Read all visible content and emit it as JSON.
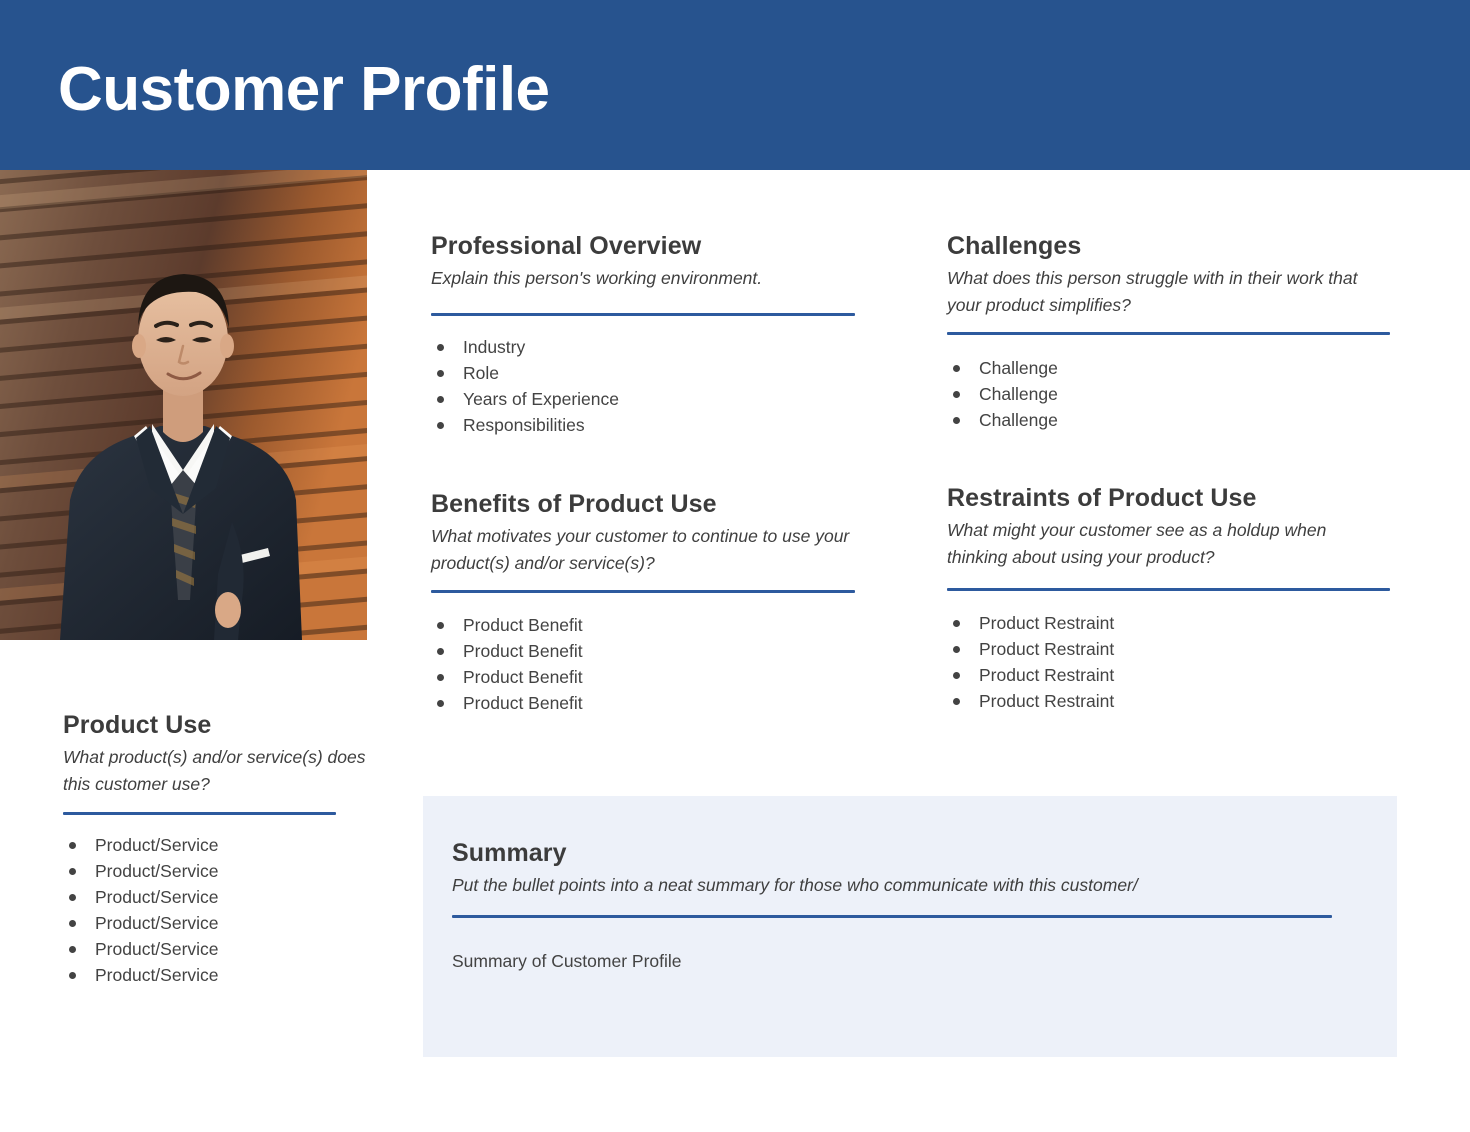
{
  "header": {
    "title": "Customer Profile",
    "background_color": "#27538E"
  },
  "photo": {
    "alt": "Professional man in dark suit standing against a wooden slat wall"
  },
  "accent_color": "#2D5A9E",
  "summary_panel_color": "#EDF1F9",
  "sections": {
    "professional_overview": {
      "title": "Professional Overview",
      "subtitle": "Explain this person's working environment.",
      "items": [
        "Industry",
        "Role",
        "Years of Experience",
        "Responsibilities"
      ]
    },
    "challenges": {
      "title": "Challenges",
      "subtitle": "What does this person struggle with in their work that your product simplifies?",
      "items": [
        "Challenge",
        "Challenge",
        "Challenge"
      ]
    },
    "benefits": {
      "title": "Benefits of Product Use",
      "subtitle": "What motivates your customer to continue to use your product(s) and/or service(s)?",
      "items": [
        "Product Benefit",
        "Product Benefit",
        "Product Benefit",
        "Product Benefit"
      ]
    },
    "restraints": {
      "title": "Restraints of Product Use",
      "subtitle": "What might your customer see as a holdup when thinking about using your product?",
      "items": [
        "Product Restraint",
        "Product Restraint",
        "Product Restraint",
        "Product Restraint"
      ]
    },
    "product_use": {
      "title": "Product Use",
      "subtitle": "What product(s) and/or service(s) does this customer use?",
      "items": [
        "Product/Service",
        "Product/Service",
        "Product/Service",
        "Product/Service",
        "Product/Service",
        "Product/Service"
      ]
    },
    "summary": {
      "title": "Summary",
      "subtitle": "Put the bullet points into a neat summary for those who communicate with this customer/",
      "body": "Summary of Customer Profile"
    }
  }
}
